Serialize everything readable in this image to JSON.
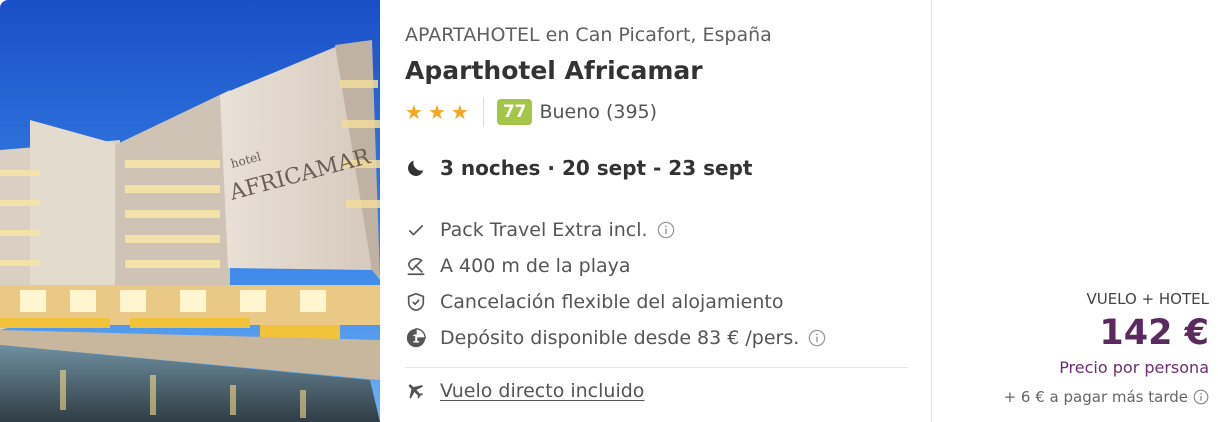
{
  "hotel": {
    "type_location": "APARTAHOTEL en Can Picafort, España",
    "name": "Aparthotel Africamar",
    "stars": 3,
    "score": "77",
    "score_label": "Bueno (395)",
    "photo_sign": "AFRICAMAR",
    "photo_sign_small": "hotel"
  },
  "stay": {
    "text": "3 noches · 20 sept - 23 sept",
    "icon": "moon-icon"
  },
  "features": [
    {
      "icon": "check-icon",
      "label": "Pack Travel Extra incl.",
      "info": true
    },
    {
      "icon": "beach-umbrella-icon",
      "label": "A 400 m de la playa",
      "info": false
    },
    {
      "icon": "shield-check-icon",
      "label": "Cancelación flexible del alojamiento",
      "info": false
    },
    {
      "icon": "deposit-icon",
      "label": "Depósito disponible desde 83 € /pers.",
      "info": true
    }
  ],
  "flight": {
    "icon": "airplane-icon",
    "label": "Vuelo directo incluido"
  },
  "pricing": {
    "package_label": "VUELO + HOTEL",
    "price": "142 €",
    "per_person": "Precio por persona",
    "extra": "+ 6 € a pagar más tarde"
  },
  "colors": {
    "star": "#f5a623",
    "score_badge": "#a3c548",
    "price": "#5a2a5e"
  }
}
